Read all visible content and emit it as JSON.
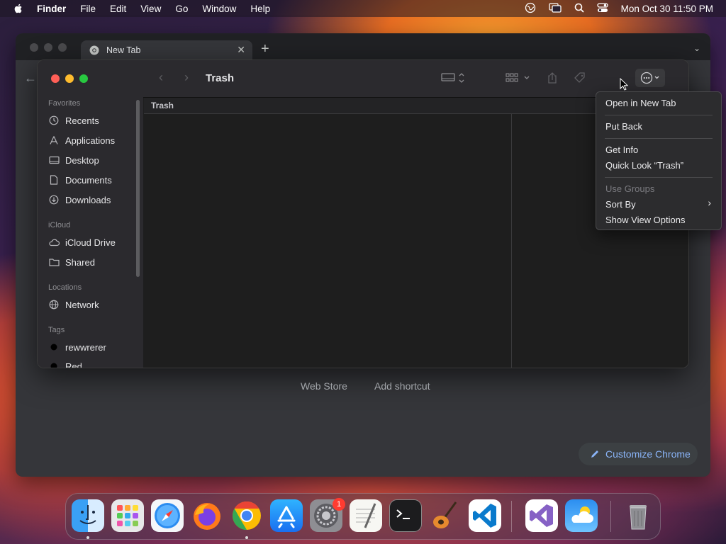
{
  "menubar": {
    "app_name": "Finder",
    "items": [
      "File",
      "Edit",
      "View",
      "Go",
      "Window",
      "Help"
    ],
    "clock": "Mon Oct 30  11:50 PM",
    "status_icons": [
      "vpn-icon",
      "screen-mirroring-icon",
      "spotlight-search-icon",
      "control-center-icon"
    ]
  },
  "chrome": {
    "tab_title": "New Tab",
    "links": [
      "Web Store",
      "Add shortcut"
    ],
    "customize_label": "Customize Chrome"
  },
  "finder": {
    "title": "Trash",
    "column_header": "Trash",
    "sidebar": {
      "sections": {
        "favorites": "Favorites",
        "icloud": "iCloud",
        "locations": "Locations",
        "tags": "Tags"
      },
      "favorites": [
        "Recents",
        "Applications",
        "Desktop",
        "Documents",
        "Downloads"
      ],
      "icloud": [
        "iCloud Drive",
        "Shared"
      ],
      "locations": [
        "Network"
      ],
      "tags": [
        "rewwrerer",
        "Red"
      ]
    }
  },
  "context_menu": {
    "items": {
      "open_in_new_tab": "Open in New Tab",
      "put_back": "Put Back",
      "get_info": "Get Info",
      "quick_look": "Quick Look “Trash”",
      "use_groups": "Use Groups",
      "sort_by": "Sort By",
      "show_view_options": "Show View Options"
    }
  },
  "dock": {
    "apps": [
      "Finder",
      "Launchpad",
      "Safari",
      "Firefox",
      "Google Chrome",
      "App Store",
      "System Settings",
      "TextEdit",
      "Terminal",
      "GarageBand",
      "Visual Studio Code",
      "Visual Studio",
      "Weather",
      "Trash"
    ],
    "settings_badge": "1"
  },
  "colors": {
    "accent_blue": "#8ab4f8",
    "traffic_red": "#ff5f57",
    "traffic_yellow": "#febc2e",
    "traffic_green": "#28c840"
  }
}
